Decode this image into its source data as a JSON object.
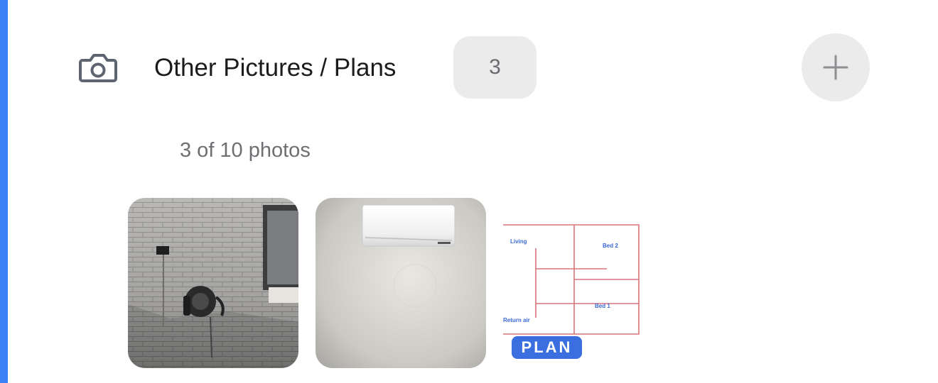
{
  "colors": {
    "accent_bar": "#3b82f6",
    "badge_bg": "#ebebeb",
    "badge_text": "#6b6b70",
    "add_button_bg": "#ebebeb",
    "add_icon": "#8e8e93",
    "camera_icon": "#5e6470",
    "subtitle_text": "#6e6e73",
    "plan_badge_bg": "#3b6fe0",
    "plan_lines": "#d9747a"
  },
  "section": {
    "icon": "camera-icon",
    "title": "Other Pictures / Plans",
    "count": "3",
    "add_icon": "plus-icon"
  },
  "photos": {
    "summary": "3 of 10 photos",
    "items": [
      {
        "name": "brick wall with hose reel"
      },
      {
        "name": "wall-mounted air conditioner"
      },
      {
        "name": "floor plan",
        "labels": {
          "living": "Living",
          "bed2": "Bed 2",
          "bed1": "Bed 1",
          "return_air": "Return air"
        },
        "badge": "PLAN"
      }
    ]
  }
}
